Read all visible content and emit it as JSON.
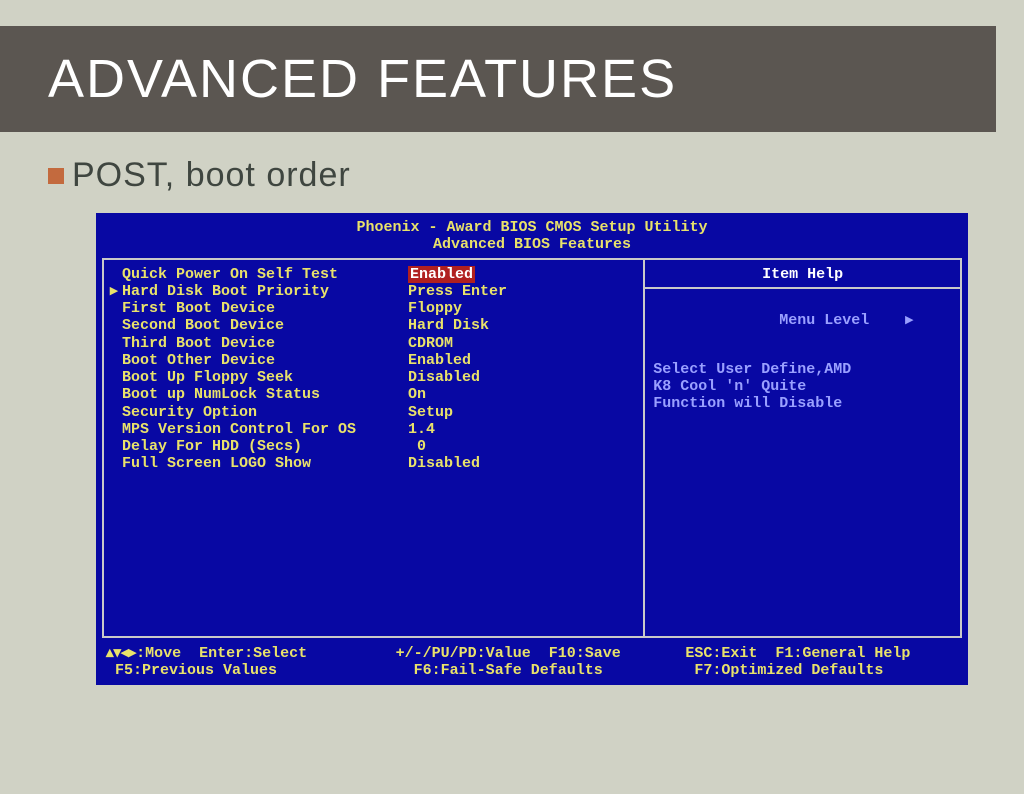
{
  "slide": {
    "title": "ADVANCED FEATURES",
    "bullet": "POST, boot order"
  },
  "bios": {
    "header_line1": "Phoenix - Award BIOS CMOS Setup Utility",
    "header_line2": "Advanced BIOS Features",
    "items": [
      {
        "label": "Quick Power On Self Test",
        "value": "Enabled",
        "pointer": false,
        "highlight": true
      },
      {
        "label": "Hard Disk Boot Priority",
        "value": "Press Enter",
        "pointer": true,
        "highlight": false
      },
      {
        "label": "First Boot Device",
        "value": "Floppy",
        "pointer": false,
        "highlight": false
      },
      {
        "label": "Second Boot Device",
        "value": "Hard Disk",
        "pointer": false,
        "highlight": false
      },
      {
        "label": "Third Boot Device",
        "value": "CDROM",
        "pointer": false,
        "highlight": false
      },
      {
        "label": "Boot Other Device",
        "value": "Enabled",
        "pointer": false,
        "highlight": false
      },
      {
        "label": "Boot Up Floppy Seek",
        "value": "Disabled",
        "pointer": false,
        "highlight": false
      },
      {
        "label": "Boot up NumLock Status",
        "value": "On",
        "pointer": false,
        "highlight": false
      },
      {
        "label": "Security Option",
        "value": "Setup",
        "pointer": false,
        "highlight": false
      },
      {
        "label": "MPS Version Control For OS",
        "value": "1.4",
        "pointer": false,
        "highlight": false
      },
      {
        "label": "Delay For HDD (Secs)",
        "value": " 0",
        "pointer": false,
        "highlight": false
      },
      {
        "label": "Full Screen LOGO Show",
        "value": "Disabled",
        "pointer": false,
        "highlight": false
      }
    ],
    "help": {
      "title": "Item Help",
      "menu_level_label": "Menu Level",
      "menu_level_arrow": "▸",
      "body": "Select User Define,AMD\nK8 Cool 'n' Quite\nFunction will Disable"
    },
    "footer": {
      "l1c1": "▴▾◂▸:Move  Enter:Select",
      "l1c2": "+/-/PU/PD:Value  F10:Save",
      "l1c3": "ESC:Exit  F1:General Help",
      "l2c1": " F5:Previous Values",
      "l2c2": "  F6:Fail-Safe Defaults",
      "l2c3": " F7:Optimized Defaults"
    }
  }
}
